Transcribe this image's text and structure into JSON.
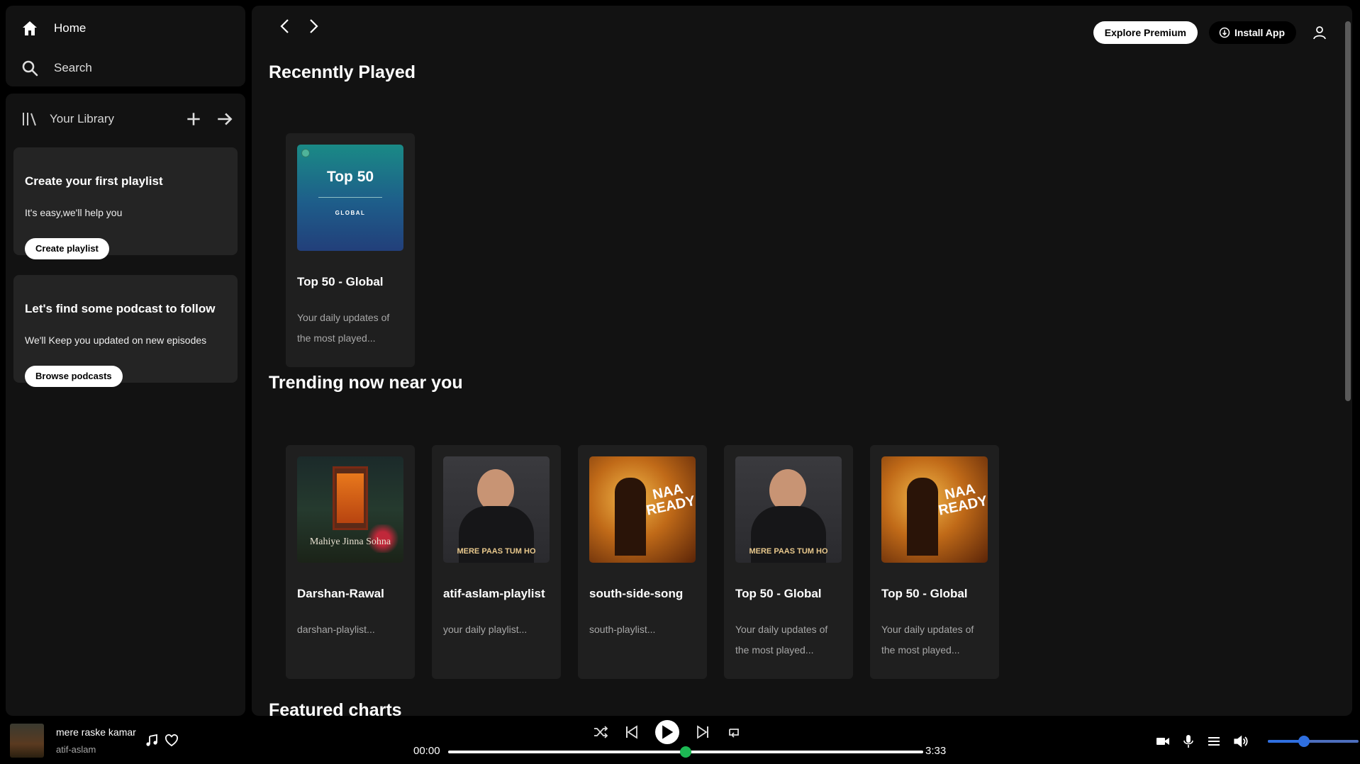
{
  "sidebar": {
    "nav": [
      {
        "label": "Home",
        "icon": "home-icon"
      },
      {
        "label": "Search",
        "icon": "search-icon"
      }
    ],
    "library": {
      "title": "Your Library",
      "add_icon": "plus-icon",
      "expand_icon": "arrow-right-icon"
    },
    "promos": [
      {
        "title": "Create your first playlist",
        "subtitle": "It's easy,we'll help you",
        "button": "Create playlist"
      },
      {
        "title": "Let's find some podcast to follow",
        "subtitle": "We'll Keep you updated on new episodes",
        "button": "Browse podcasts"
      }
    ]
  },
  "header": {
    "premium_label": "Explore Premium",
    "install_label": "Install App"
  },
  "sections": {
    "recent": {
      "title": "Recenntly Played",
      "cards": [
        {
          "title": "Top 50 - Global",
          "desc": "Your daily updates of the most played...",
          "cover_text": "Top 50",
          "cover_sub": "GLOBAL"
        }
      ]
    },
    "trending": {
      "title": "Trending now near you",
      "cards": [
        {
          "title": "Darshan-Rawal",
          "desc": "darshan-playlist...",
          "cover_text": "Mahiye Jinna Sohna"
        },
        {
          "title": "atif-aslam-playlist",
          "desc": "your daily playlist...",
          "cover_text": "MERE PAAS TUM HO"
        },
        {
          "title": "south-side-song",
          "desc": "south-playlist...",
          "cover_text": "NAA READY"
        },
        {
          "title": "Top 50 - Global",
          "desc": "Your daily updates of the most played...",
          "cover_text": "MERE PAAS TUM HO"
        },
        {
          "title": "Top 50 - Global",
          "desc": "Your daily updates of the most played...",
          "cover_text": "NAA READY"
        }
      ]
    },
    "featured": {
      "title": "Featured charts"
    }
  },
  "player": {
    "track": "mere raske kamar",
    "artist": "atif-aslam",
    "current_time": "00:00",
    "duration": "3:33",
    "progress": 0.5,
    "volume": 0.4
  },
  "colors": {
    "accent": "#1db954",
    "volume": "#2f6fe0"
  }
}
